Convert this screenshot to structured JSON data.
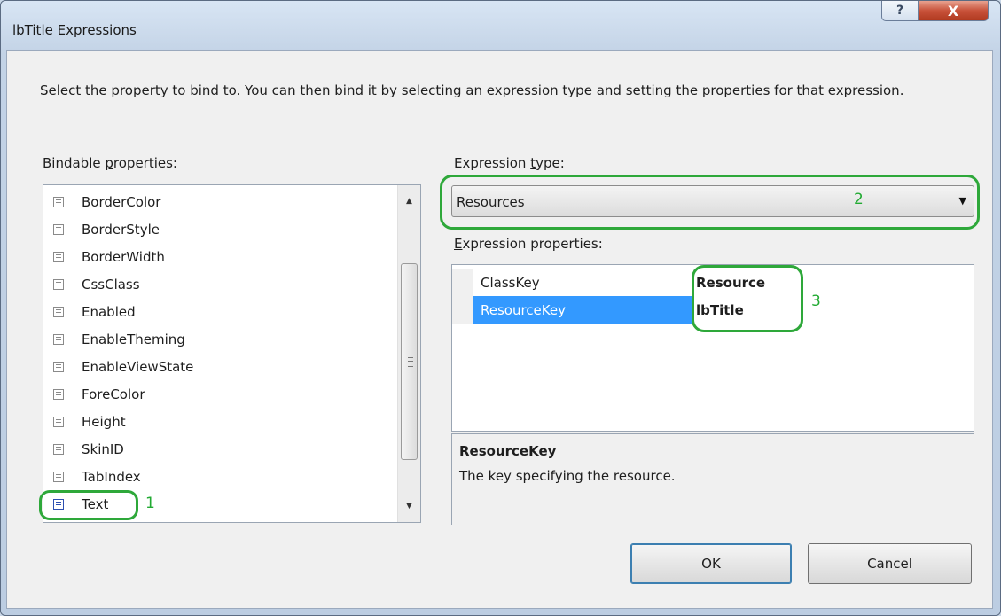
{
  "window": {
    "title": "lbTitle Expressions",
    "help_glyph": "?",
    "close_glyph": "X"
  },
  "description": "Select the property to bind to.  You can then bind it by selecting an expression type and setting the properties for that expression.",
  "bindable": {
    "label_pre": "Bindable ",
    "label_key": "p",
    "label_post": "roperties:",
    "items": [
      {
        "label": "BorderColor"
      },
      {
        "label": "BorderStyle"
      },
      {
        "label": "BorderWidth"
      },
      {
        "label": "CssClass"
      },
      {
        "label": "Enabled"
      },
      {
        "label": "EnableTheming"
      },
      {
        "label": "EnableViewState"
      },
      {
        "label": "ForeColor"
      },
      {
        "label": "Height"
      },
      {
        "label": "SkinID"
      },
      {
        "label": "TabIndex"
      },
      {
        "label": "Text"
      }
    ],
    "icon": "property-icon",
    "scroll_up": "▲",
    "scroll_down": "▼"
  },
  "expression_type": {
    "label_pre": "Expression ",
    "label_key": "t",
    "label_post": "ype:",
    "selected": "Resources",
    "arrow": "▼"
  },
  "expression_properties": {
    "label_pre": "",
    "label_key": "E",
    "label_post": "xpression properties:",
    "rows": [
      {
        "name": "ClassKey",
        "value": "Resource"
      },
      {
        "name": "ResourceKey",
        "value": "lbTitle"
      }
    ]
  },
  "help": {
    "title": "ResourceKey",
    "text": "The key specifying the resource."
  },
  "buttons": {
    "ok": "OK",
    "cancel": "Cancel"
  },
  "annotations": [
    "1",
    "2",
    "3"
  ],
  "colors": {
    "annotation": "#2ea83a",
    "selection": "#3399ff"
  }
}
